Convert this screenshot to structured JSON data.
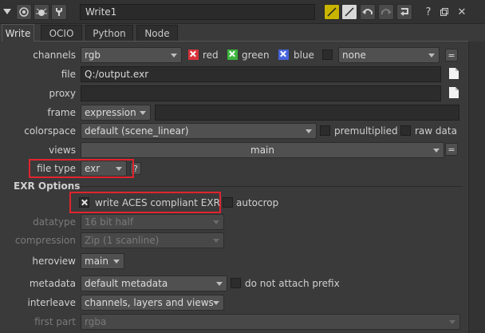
{
  "node": {
    "name": "Write1"
  },
  "tabs": [
    {
      "label": "Write",
      "active": true
    },
    {
      "label": "OCIO",
      "active": false
    },
    {
      "label": "Python",
      "active": false
    },
    {
      "label": "Node",
      "active": false
    }
  ],
  "params": {
    "channels": {
      "label": "channels",
      "value": "rgb",
      "red": {
        "label": "red",
        "checked": true,
        "color": "#d8323c"
      },
      "green": {
        "label": "green",
        "checked": true,
        "color": "#3cb43c"
      },
      "blue": {
        "label": "blue",
        "checked": true,
        "color": "#4664dc"
      },
      "extra_value": "none",
      "more_button": "="
    },
    "file": {
      "label": "file",
      "value": "Q:/output.exr"
    },
    "proxy": {
      "label": "proxy",
      "value": ""
    },
    "frame": {
      "label": "frame",
      "mode": "expression",
      "value": ""
    },
    "colorspace": {
      "label": "colorspace",
      "value": "default (scene_linear)",
      "premultiplied_label": "premultiplied",
      "raw_data_label": "raw data"
    },
    "views": {
      "label": "views",
      "value": "main",
      "more_button": "="
    },
    "file_type": {
      "label": "file type",
      "value": "exr"
    }
  },
  "exr": {
    "section_title": "EXR Options",
    "write_aces": {
      "label": "write ACES compliant EXR",
      "checked": true
    },
    "autocrop": {
      "label": "autocrop",
      "checked": false
    },
    "datatype": {
      "label": "datatype",
      "value": "16 bit half",
      "enabled": false
    },
    "compression": {
      "label": "compression",
      "value": "Zip (1 scanline)",
      "enabled": false
    },
    "heroview": {
      "label": "heroview",
      "value": "main"
    },
    "metadata": {
      "label": "metadata",
      "value": "default metadata",
      "no_prefix_label": "do not attach prefix"
    },
    "interleave": {
      "label": "interleave",
      "value": "channels, layers and views"
    },
    "first_part": {
      "label": "first part",
      "value": "rgba",
      "enabled": false
    }
  },
  "colors": {
    "highlight": "#e0242f",
    "panel_bg": "#3a3a3a"
  },
  "icons": [
    "collapse-triangle-icon",
    "viewer-node-icon",
    "bug-icon",
    "wrench-icon",
    "color-chip-icon",
    "color-chip-2-icon",
    "undo-icon",
    "redo-icon",
    "revert-icon",
    "help-icon",
    "float-icon",
    "close-icon",
    "file-browse-icon"
  ]
}
